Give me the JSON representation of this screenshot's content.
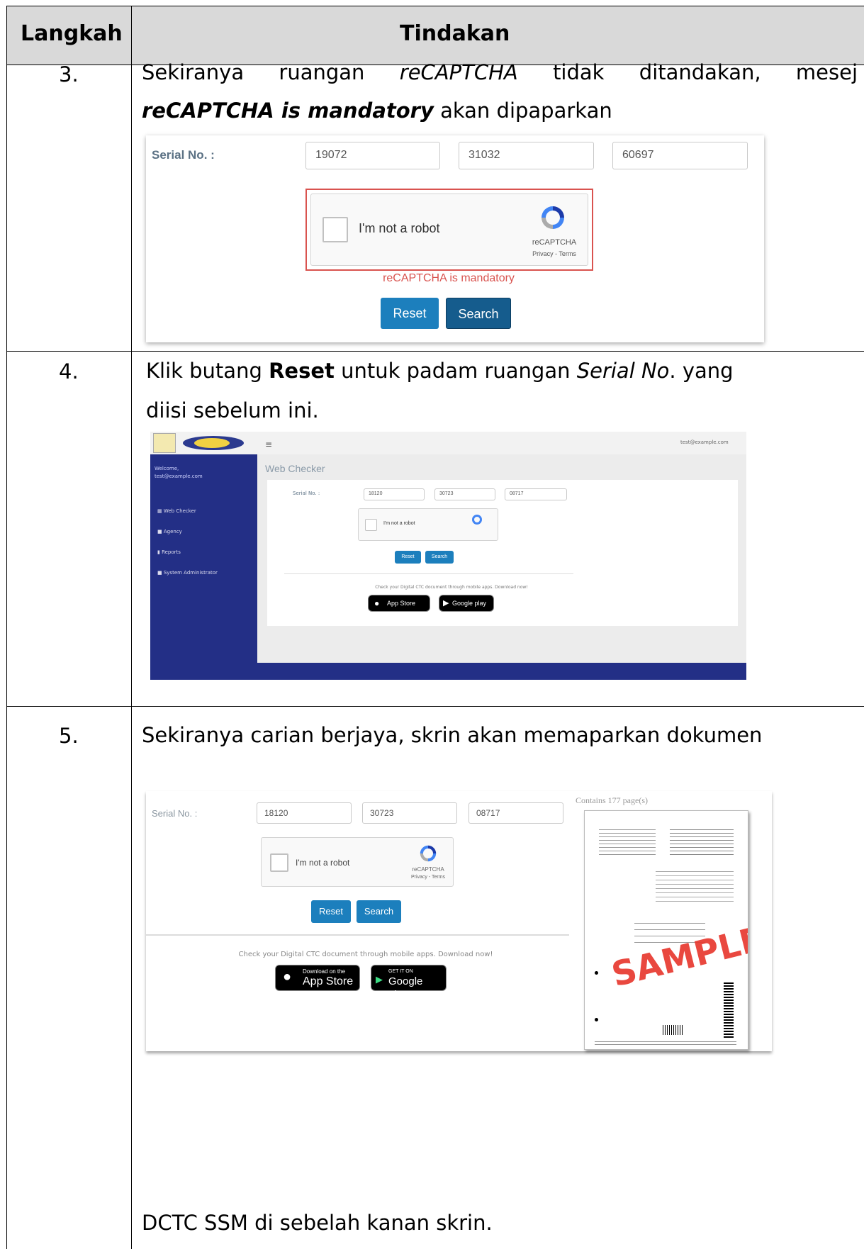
{
  "table": {
    "col1_header": "Langkah",
    "col2_header": "Tindakan"
  },
  "rows": [
    {
      "step": "3.",
      "text_a1": "Sekiranya ruangan",
      "text_a2": "reCAPTCHA",
      "text_a3": "tidak ditandakan, mesej",
      "text_b1": "reCAPTCHA is mandatory",
      "text_b2": " akan dipaparkan",
      "screenshot": {
        "serial_label": "Serial No. :",
        "serial_1": "19072",
        "serial_2": "31032",
        "serial_3": "60697",
        "captcha_text": "I'm not a robot",
        "captcha_brand": "reCAPTCHA",
        "captcha_links": "Privacy - Terms",
        "error_text": "reCAPTCHA is mandatory",
        "reset_label": "Reset",
        "search_label": "Search"
      }
    },
    {
      "step": "4.",
      "text_a1": "Klik butang ",
      "text_a2": "Reset",
      "text_a3": " untuk padam ruangan ",
      "text_a4": "Serial No",
      "text_a5": ". yang",
      "text_b": "diisi sebelum ini.",
      "screenshot": {
        "page_title": "Web Checker",
        "welcome": "Welcome,",
        "user_email": "test@example.com",
        "nav": [
          "Web Checker",
          "Agency",
          "Reports",
          "System Administrator"
        ],
        "serial_label": "Serial No. :",
        "serial_1": "18120",
        "serial_2": "30723",
        "serial_3": "08717",
        "captcha_text": "I'm not a robot",
        "reset_label": "Reset",
        "search_label": "Search",
        "promo_text": "Check your Digital CTC document through mobile apps. Download now!",
        "appstore_label": "App Store",
        "googleplay_label": "Google play"
      }
    },
    {
      "step": "5.",
      "text_a": "Sekiranya carian berjaya, skrin akan memaparkan dokumen",
      "text_b": "DCTC SSM di sebelah kanan skrin.",
      "screenshot": {
        "serial_label": "Serial No. :",
        "serial_1": "18120",
        "serial_2": "30723",
        "serial_3": "08717",
        "captcha_text": "I'm not a robot",
        "captcha_brand": "reCAPTCHA",
        "captcha_links": "Privacy - Terms",
        "reset_label": "Reset",
        "search_label": "Search",
        "promo_text": "Check your Digital CTC document through mobile apps. Download now!",
        "appstore_small": "Download on the",
        "appstore_label": "App Store",
        "googleplay_small": "GET IT ON",
        "googleplay_label": "Google play",
        "pages_text": "Contains 177 page(s)",
        "watermark": "SAMPLE"
      }
    }
  ],
  "colors": {
    "header_bg": "#d9d9d9",
    "sidebar": "#232f86",
    "button_blue": "#1f78b4",
    "error_red": "#d9534f"
  }
}
